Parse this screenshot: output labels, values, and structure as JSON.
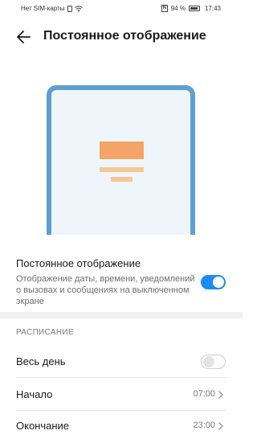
{
  "status_bar": {
    "carrier": "Нет SIM-карты",
    "battery": "94 %",
    "time": "17:43"
  },
  "header": {
    "title": "Постоянное отображение",
    "back_icon": "arrow-left-icon"
  },
  "aod": {
    "title": "Постоянное отображение",
    "description": "Отображение даты, времени, уведомлений о вызовах и сообщениях на выключенном экране",
    "enabled": true,
    "accent_color": "#1a8df5"
  },
  "schedule": {
    "section_label": "РАСПИСАНИЕ",
    "all_day": {
      "label": "Весь день",
      "enabled": false
    },
    "start": {
      "label": "Начало",
      "value": "07:00"
    },
    "end": {
      "label": "Окончание",
      "value": "23:00"
    }
  }
}
